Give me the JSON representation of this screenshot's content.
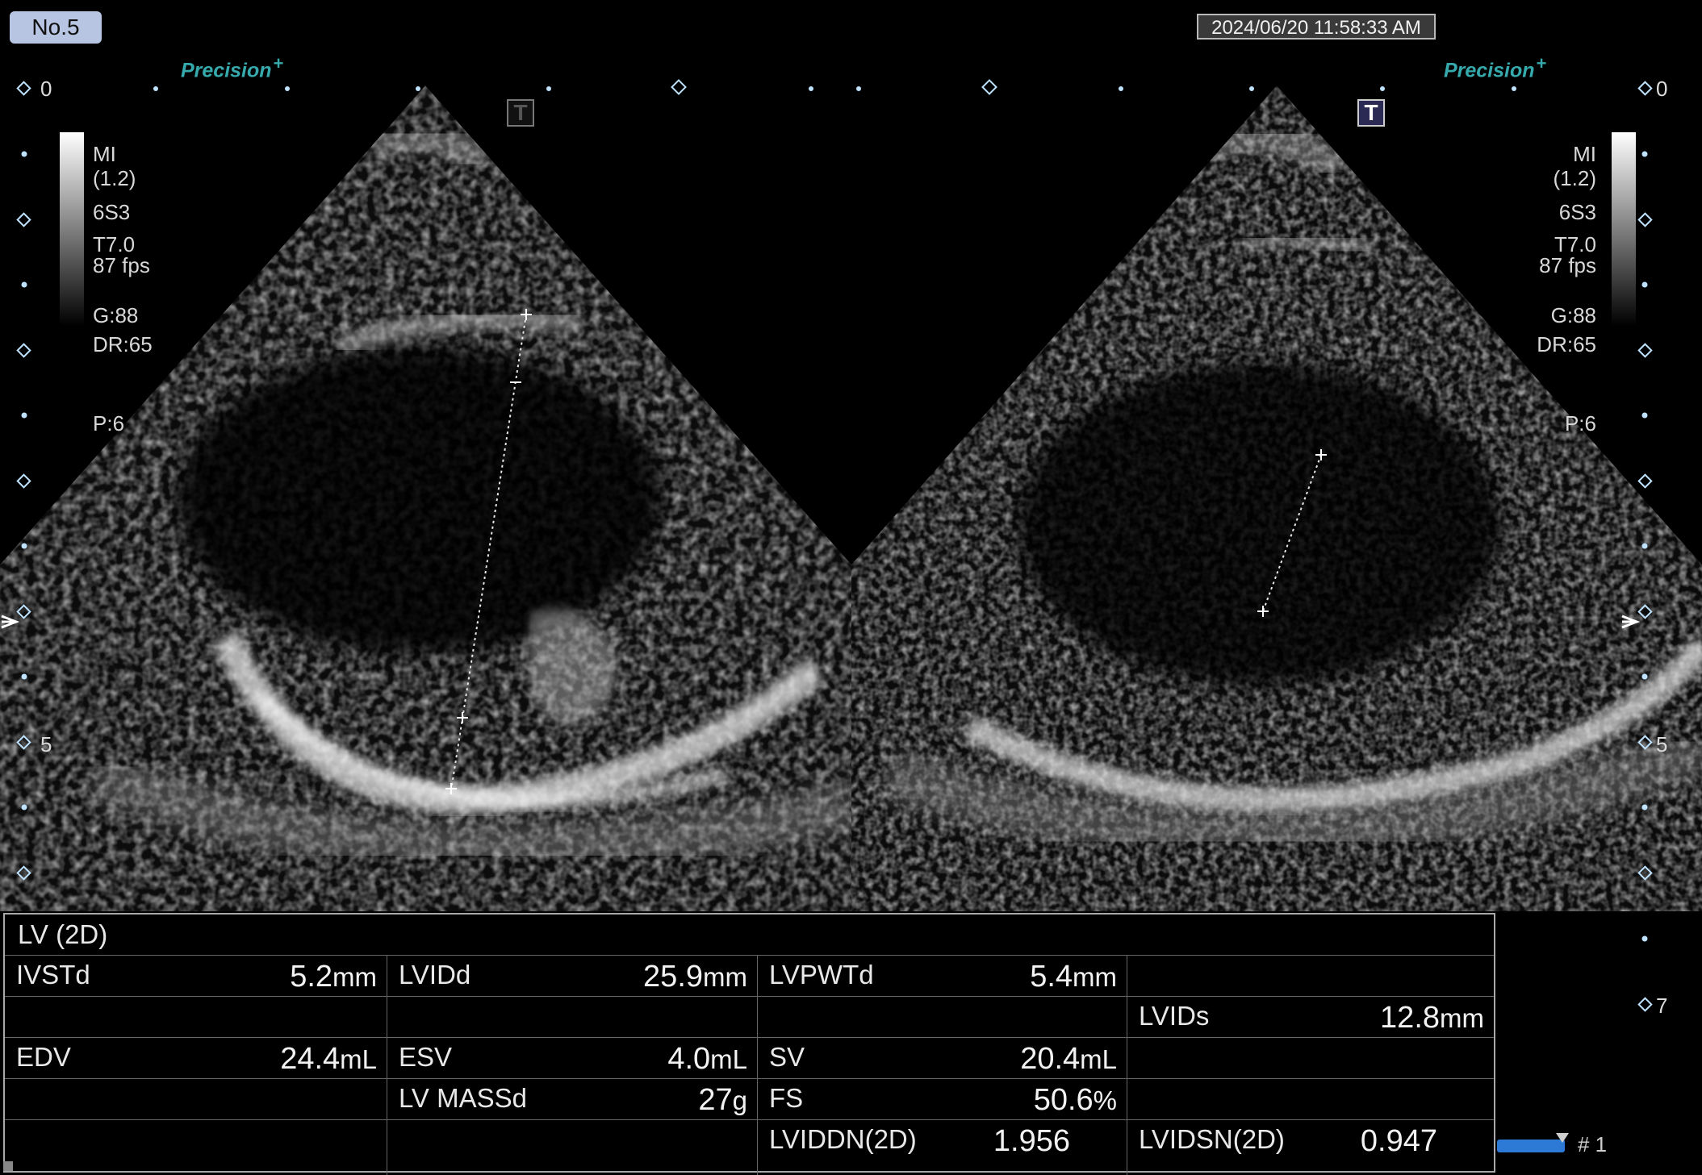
{
  "header": {
    "image_number": "No.5",
    "datetime": "2024/06/20 11:58:33 AM"
  },
  "branding": {
    "left": "Precision",
    "right": "Precision",
    "mark": "+",
    "color": "#36a9ac"
  },
  "left_panel": {
    "params": [
      "MI",
      "(1.2)",
      "6S3",
      "T7.0",
      "87 fps",
      "G:88",
      "DR:65",
      "P:6"
    ],
    "t_icon": "T",
    "depth_labels": [
      "0",
      "5"
    ]
  },
  "right_panel": {
    "params": [
      "MI",
      "(1.2)",
      "6S3",
      "T7.0",
      "87 fps",
      "G:88",
      "DR:65",
      "P:6"
    ],
    "t_icon": "T",
    "depth_labels": [
      "0",
      "5",
      "7"
    ]
  },
  "measurements": {
    "title": "LV (2D)",
    "rows": [
      [
        {
          "label": "IVSTd",
          "value": "5.2",
          "unit": "mm"
        },
        {
          "label": "LVIDd",
          "value": "25.9",
          "unit": "mm"
        },
        {
          "label": "LVPWTd",
          "value": "5.4",
          "unit": "mm"
        },
        {
          "label": "",
          "value": "",
          "unit": ""
        }
      ],
      [
        {
          "label": "",
          "value": "",
          "unit": ""
        },
        {
          "label": "",
          "value": "",
          "unit": ""
        },
        {
          "label": "",
          "value": "",
          "unit": ""
        },
        {
          "label": "LVIDs",
          "value": "12.8",
          "unit": "mm"
        }
      ],
      [
        {
          "label": "EDV",
          "value": "24.4",
          "unit": "mL"
        },
        {
          "label": "ESV",
          "value": "4.0",
          "unit": "mL"
        },
        {
          "label": "SV",
          "value": "20.4",
          "unit": "mL"
        },
        {
          "label": "",
          "value": "",
          "unit": ""
        }
      ],
      [
        {
          "label": "",
          "value": "",
          "unit": ""
        },
        {
          "label": "LV MASSd",
          "value": "27",
          "unit": "g"
        },
        {
          "label": "FS",
          "value": "50.6",
          "unit": "%"
        },
        {
          "label": "",
          "value": "",
          "unit": ""
        }
      ],
      [
        {
          "label": "",
          "value": "",
          "unit": ""
        },
        {
          "label": "",
          "value": "",
          "unit": ""
        },
        {
          "label": "LVIDDN(2D)",
          "value": "1.956",
          "unit": ""
        },
        {
          "label": "LVIDSN(2D)",
          "value": "0.947",
          "unit": ""
        }
      ]
    ]
  },
  "footer": {
    "page_indicator": "# 1"
  }
}
